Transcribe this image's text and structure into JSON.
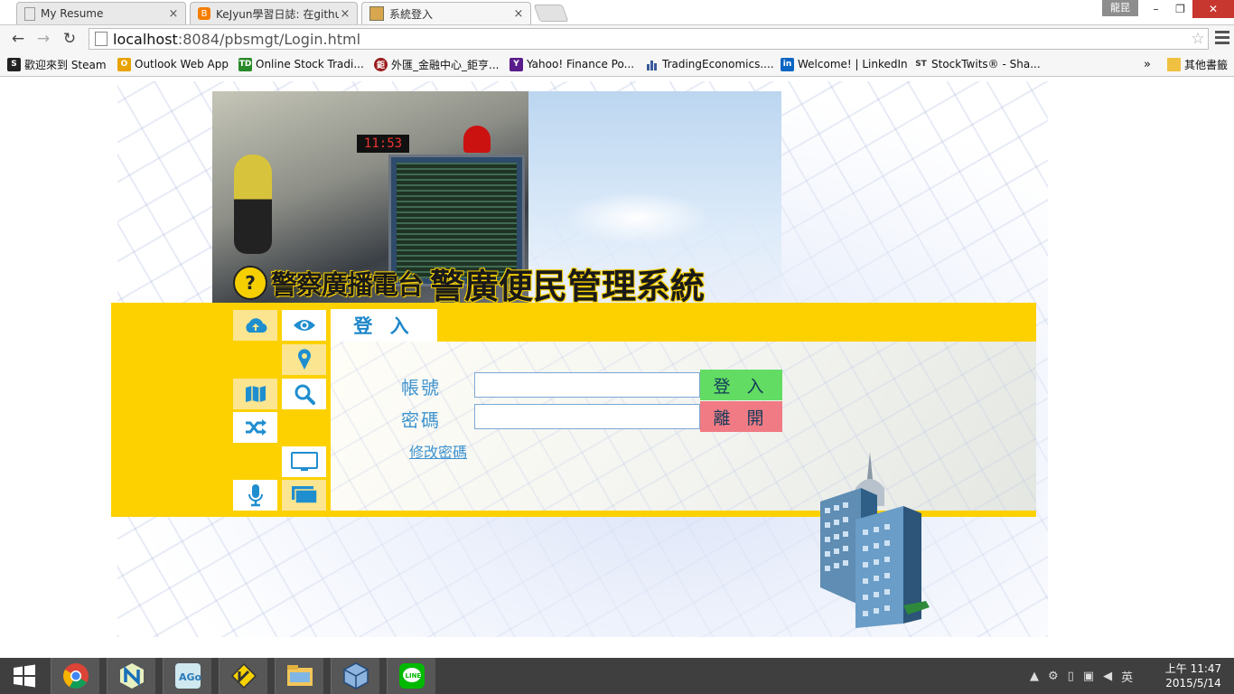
{
  "tabs": [
    {
      "title": "My Resume",
      "close": "×"
    },
    {
      "title": "KeJyun學習日誌: 在githul",
      "close": "×"
    },
    {
      "title": "系統登入",
      "close": "×"
    }
  ],
  "window": {
    "profile": "龍昆",
    "minimize": "–",
    "restore": "❐",
    "close": "✕"
  },
  "toolbar": {
    "back": "←",
    "forward": "→",
    "reload": "↻",
    "star": "☆"
  },
  "address": {
    "host": "localhost",
    "rest": ":8084/pbsmgt/Login.html"
  },
  "bookmarks": [
    {
      "label": "歡迎來到 Steam",
      "icon": "steam-icon",
      "color": "#222222"
    },
    {
      "label": "Outlook Web App",
      "icon": "outlook-icon",
      "color": "#e8a300"
    },
    {
      "label": "Online Stock Tradi...",
      "icon": "td-icon",
      "color": "#2a8a2a"
    },
    {
      "label": "外匯_金融中心_鉅亨...",
      "icon": "cnyes-icon",
      "color": "#9b1c1c"
    },
    {
      "label": "Yahoo! Finance Po...",
      "icon": "yahoo-icon",
      "color": "#5a1c8a"
    },
    {
      "label": "TradingEconomics....",
      "icon": "bar-chart-icon",
      "color": "#3a5a9a"
    },
    {
      "label": "Welcome! | LinkedIn",
      "icon": "linkedin-icon",
      "color": "#0a66c2"
    },
    {
      "label": "StockTwits® - Sha...",
      "icon": "stocktwits-icon",
      "color": "#333333"
    }
  ],
  "bookmarks_overflow": "»",
  "other_bookmarks": "其他書籤",
  "page": {
    "station_name": "警察廣播電台",
    "system_name": "警廣便民管理系統",
    "clock_display": "11:53",
    "login_tab": "登 入",
    "account_label": "帳號",
    "password_label": "密碼",
    "account_value": "",
    "password_value": "",
    "login_button": "登 入",
    "exit_button": "離 開",
    "change_password_link": "修改密碼"
  },
  "side_icons": [
    "cloud-upload-icon",
    "eye-icon",
    "map-marker-icon",
    "map-icon",
    "search-icon",
    "shuffle-icon",
    "monitor-icon",
    "microphone-icon",
    "broadcast-screen-icon"
  ],
  "colors": {
    "band": "#fdd100",
    "label": "#3e93cf",
    "login_button": "#62dc63",
    "exit_button": "#f07b84"
  },
  "taskbar": {
    "apps": [
      "windows-start-icon",
      "chrome-icon",
      "netbeans-icon",
      "adobe-air-icon",
      "kakao-icon",
      "file-explorer-icon",
      "virtualbox-icon",
      "line-icon"
    ],
    "ime": "英",
    "time": "上午 11:47",
    "date": "2015/5/14"
  }
}
